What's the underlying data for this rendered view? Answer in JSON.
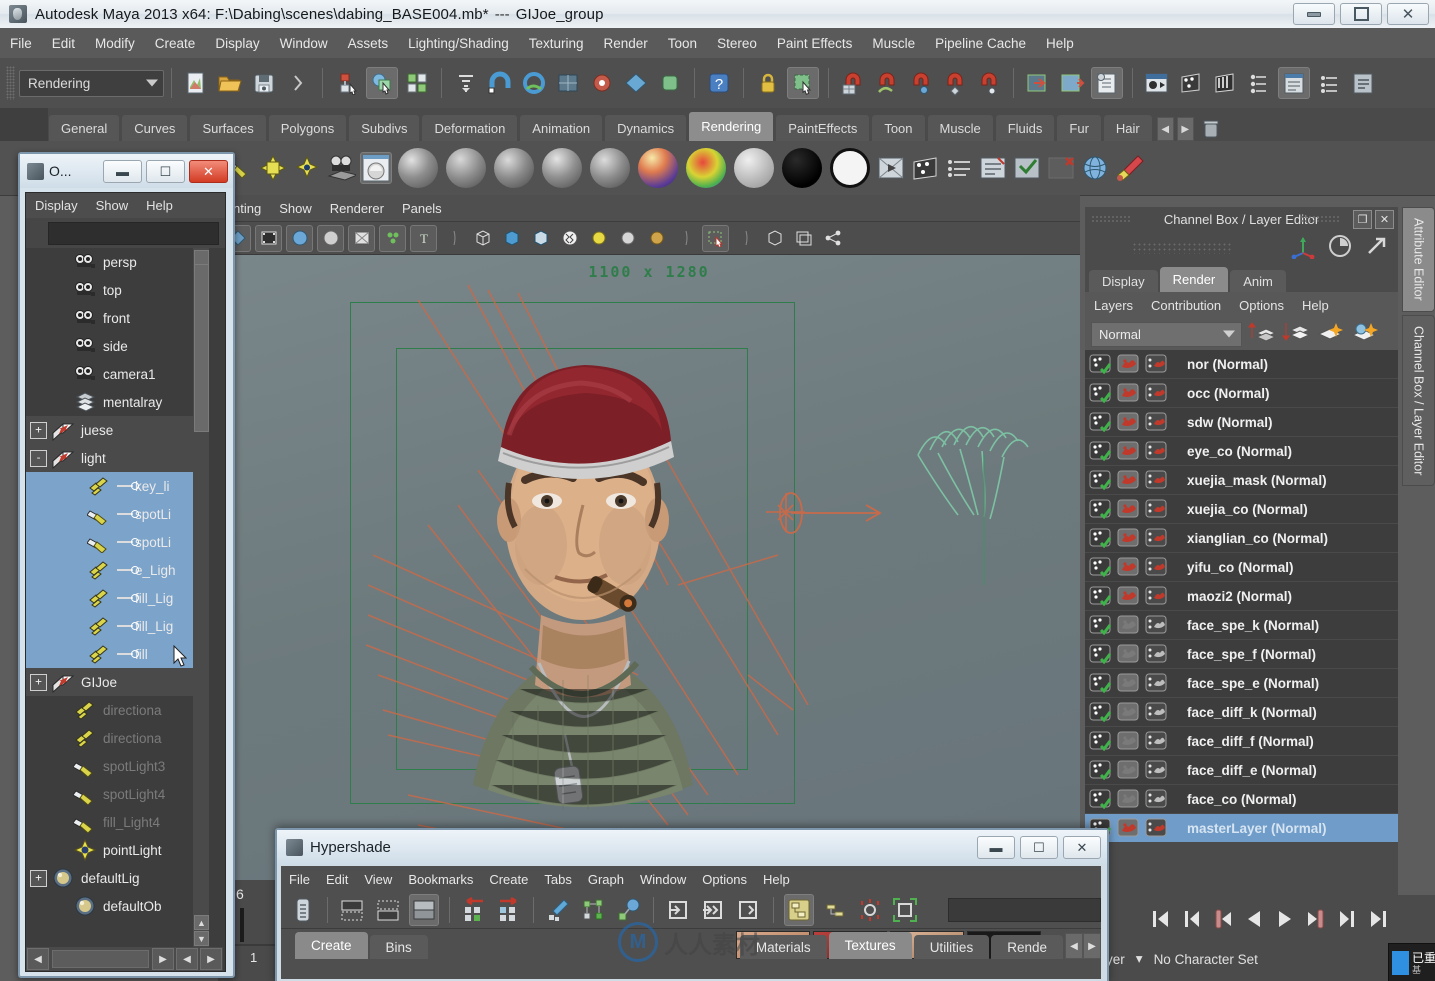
{
  "window": {
    "app_title": "Autodesk Maya 2013 x64: F:\\Dabing\\scenes\\dabing_BASE004.mb*",
    "separator": "---",
    "selection": "GIJoe_group",
    "minimize": "minimize-icon",
    "maximize": "maximize-icon",
    "close": "close-icon"
  },
  "menubar": {
    "items": [
      "File",
      "Edit",
      "Modify",
      "Create",
      "Display",
      "Window",
      "Assets",
      "Lighting/Shading",
      "Texturing",
      "Render",
      "Toon",
      "Stereo",
      "Paint Effects",
      "Muscle",
      "Pipeline Cache",
      "Help"
    ]
  },
  "toolbar": {
    "mode_menu": "Rendering"
  },
  "shelf": {
    "tabs": [
      "General",
      "Curves",
      "Surfaces",
      "Polygons",
      "Subdivs",
      "Deformation",
      "Animation",
      "Dynamics",
      "Rendering",
      "PaintEffects",
      "Toon",
      "Muscle",
      "Fluids",
      "Fur",
      "Hair"
    ],
    "active_tab": "Rendering",
    "prev_label": "◀",
    "next_label": "▶"
  },
  "outliner": {
    "title": "O...",
    "menus": [
      "Display",
      "Show",
      "Help"
    ],
    "filter_value": "",
    "items": [
      {
        "label": "persp",
        "icon": "camera-icon",
        "indent": 2,
        "state": "normal",
        "expand": ""
      },
      {
        "label": "top",
        "icon": "camera-icon",
        "indent": 2,
        "state": "normal",
        "expand": ""
      },
      {
        "label": "front",
        "icon": "camera-icon",
        "indent": 2,
        "state": "normal",
        "expand": ""
      },
      {
        "label": "side",
        "icon": "camera-icon",
        "indent": 2,
        "state": "normal",
        "expand": ""
      },
      {
        "label": "camera1",
        "icon": "camera-icon",
        "indent": 2,
        "state": "normal",
        "expand": ""
      },
      {
        "label": "mentalray",
        "icon": "stack-icon",
        "indent": 2,
        "state": "normal",
        "expand": ""
      },
      {
        "label": "juese",
        "icon": "group-icon",
        "indent": 0,
        "state": "group",
        "expand": "+"
      },
      {
        "label": "light",
        "icon": "group-icon",
        "indent": 0,
        "state": "group",
        "expand": "-"
      },
      {
        "label": "key_li",
        "icon": "directional-light-icon",
        "indent": 3,
        "state": "selected",
        "expand": ""
      },
      {
        "label": "spotLi",
        "icon": "spot-light-icon",
        "indent": 3,
        "state": "selected",
        "expand": ""
      },
      {
        "label": "spotLi",
        "icon": "spot-light-icon",
        "indent": 3,
        "state": "selected",
        "expand": ""
      },
      {
        "label": "e_Ligh",
        "icon": "directional-light-icon",
        "indent": 3,
        "state": "selected",
        "expand": ""
      },
      {
        "label": "fill_Lig",
        "icon": "directional-light-icon",
        "indent": 3,
        "state": "selected",
        "expand": ""
      },
      {
        "label": "fill_Lig",
        "icon": "directional-light-icon",
        "indent": 3,
        "state": "selected",
        "expand": ""
      },
      {
        "label": "fill",
        "icon": "directional-light-icon",
        "indent": 3,
        "state": "selected",
        "expand": ""
      },
      {
        "label": "GIJoe",
        "icon": "group-icon",
        "indent": 0,
        "state": "group",
        "expand": "+"
      },
      {
        "label": "directiona",
        "icon": "directional-light-icon",
        "indent": 2,
        "state": "dim",
        "expand": ""
      },
      {
        "label": "directiona",
        "icon": "directional-light-icon",
        "indent": 2,
        "state": "dim",
        "expand": ""
      },
      {
        "label": "spotLight3",
        "icon": "spot-light-icon",
        "indent": 2,
        "state": "dim",
        "expand": ""
      },
      {
        "label": "spotLight4",
        "icon": "spot-light-icon",
        "indent": 2,
        "state": "dim",
        "expand": ""
      },
      {
        "label": "fill_Light4",
        "icon": "spot-light-icon",
        "indent": 2,
        "state": "dim",
        "expand": ""
      },
      {
        "label": "pointLight",
        "icon": "point-light-icon",
        "indent": 2,
        "state": "normal",
        "expand": ""
      },
      {
        "label": "defaultLig",
        "icon": "shader-ball-icon",
        "indent": 0,
        "state": "normal",
        "expand": "+"
      },
      {
        "label": "defaultOb",
        "icon": "shader-ball-icon",
        "indent": 2,
        "state": "normal",
        "expand": ""
      }
    ]
  },
  "viewport": {
    "menus": [
      "nting",
      "Show",
      "Renderer",
      "Panels"
    ],
    "resolution": "1100 x 1280"
  },
  "right_panel": {
    "title": "Channel Box / Layer Editor",
    "restore_label": "❐",
    "close_label": "✕",
    "tabs": [
      "Display",
      "Render",
      "Anim"
    ],
    "active_tab": "Render",
    "menus": [
      "Layers",
      "Contribution",
      "Options",
      "Help"
    ],
    "mode": "Normal",
    "layers": [
      {
        "name": "nor (Normal)",
        "render": true,
        "selected": false
      },
      {
        "name": "occ (Normal)",
        "render": true,
        "selected": false
      },
      {
        "name": "sdw (Normal)",
        "render": true,
        "selected": false
      },
      {
        "name": "eye_co (Normal)",
        "render": true,
        "selected": false
      },
      {
        "name": "xuejia_mask (Normal)",
        "render": true,
        "selected": false
      },
      {
        "name": "xuejia_co (Normal)",
        "render": true,
        "selected": false
      },
      {
        "name": "xianglian_co (Normal)",
        "render": true,
        "selected": false
      },
      {
        "name": "yifu_co (Normal)",
        "render": true,
        "selected": false
      },
      {
        "name": "maozi2 (Normal)",
        "render": true,
        "selected": false
      },
      {
        "name": "face_spe_k (Normal)",
        "render": false,
        "selected": false
      },
      {
        "name": "face_spe_f (Normal)",
        "render": false,
        "selected": false
      },
      {
        "name": "face_spe_e (Normal)",
        "render": false,
        "selected": false
      },
      {
        "name": "face_diff_k (Normal)",
        "render": false,
        "selected": false
      },
      {
        "name": "face_diff_f (Normal)",
        "render": false,
        "selected": false
      },
      {
        "name": "face_diff_e (Normal)",
        "render": false,
        "selected": false
      },
      {
        "name": "face_co (Normal)",
        "render": false,
        "selected": false
      },
      {
        "name": "masterLayer (Normal)",
        "render": true,
        "selected": true
      }
    ]
  },
  "side_tabs": {
    "attribute_editor": "Attribute Editor",
    "channel_box": "Channel Box / Layer Editor"
  },
  "hypershade": {
    "title": "Hypershade",
    "minimize": "minimize-icon",
    "maximize": "maximize-icon",
    "close": "close-icon",
    "menus": [
      "File",
      "Edit",
      "View",
      "Bookmarks",
      "Create",
      "Tabs",
      "Graph",
      "Window",
      "Options",
      "Help"
    ],
    "search_value": "",
    "left_tabs": [
      "Create",
      "Bins"
    ],
    "left_active": "Create",
    "right_tabs": [
      "Materials",
      "Textures",
      "Utilities",
      "Rende"
    ],
    "right_active": "Textures",
    "prev_label": "◀",
    "next_label": "▶"
  },
  "timeline": {
    "frame_top": "6",
    "frame_bottom": "1"
  },
  "playback": {
    "buttons": [
      "go-to-start",
      "step-back-keyframe",
      "step-back-frame",
      "play-backwards",
      "play-forwards",
      "step-forward-frame",
      "step-forward-keyframe",
      "go-to-end"
    ],
    "layer_label": "Layer",
    "character_set": "No Character Set"
  },
  "watermark": {
    "mark": "M",
    "text": "人人素材"
  },
  "toast": {
    "line1": "已重",
    "line2": "基"
  },
  "colors": {
    "accent_blue": "#7ca3c9",
    "selection_blue": "#6f9cc8",
    "resolution_green": "#2f7d4a",
    "panel_bg": "#4b4b4b",
    "tree_bg": "#3d3d3d"
  }
}
